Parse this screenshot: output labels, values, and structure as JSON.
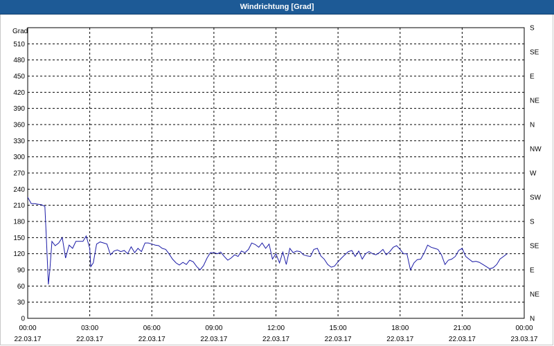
{
  "window": {
    "title": "Windrichtung [Grad]"
  },
  "colors": {
    "titlebar": "#1d5a96",
    "line": "#1a1aa6",
    "grid": "#000000"
  },
  "chart_data": {
    "type": "line",
    "title": "Windrichtung [Grad]",
    "ylabel": "Grad",
    "ylim": [
      0,
      540
    ],
    "yticks": [
      0,
      30,
      60,
      90,
      120,
      150,
      180,
      210,
      240,
      270,
      300,
      330,
      360,
      390,
      420,
      450,
      480,
      510
    ],
    "right_axis_labels": [
      "N",
      "NE",
      "E",
      "SE",
      "S",
      "SW",
      "W",
      "NW",
      "N",
      "NE",
      "E",
      "SE",
      "S"
    ],
    "xlim_hours": [
      0,
      24
    ],
    "xticks": [
      {
        "time": "00:00",
        "date": "22.03.17"
      },
      {
        "time": "03:00",
        "date": "22.03.17"
      },
      {
        "time": "06:00",
        "date": "22.03.17"
      },
      {
        "time": "09:00",
        "date": "22.03.17"
      },
      {
        "time": "12:00",
        "date": "22.03.17"
      },
      {
        "time": "15:00",
        "date": "22.03.17"
      },
      {
        "time": "18:00",
        "date": "22.03.17"
      },
      {
        "time": "21:00",
        "date": "22.03.17"
      },
      {
        "time": "00:00",
        "date": "23.03.17"
      }
    ],
    "grid": true,
    "series": [
      {
        "x_hours": [
          0,
          0.17,
          0.33,
          0.5,
          0.67,
          0.83,
          0.9,
          1.0,
          1.07,
          1.17,
          1.33,
          1.5,
          1.67,
          1.83,
          2.0,
          2.17,
          2.33,
          2.5,
          2.67,
          2.83,
          3.0,
          3.05,
          3.17,
          3.33,
          3.5,
          3.67,
          3.83,
          4.0,
          4.17,
          4.33,
          4.5,
          4.67,
          4.83,
          5.0,
          5.17,
          5.33,
          5.5,
          5.67,
          5.83,
          6.0,
          6.17,
          6.33,
          6.5,
          6.67,
          6.83,
          7.0,
          7.17,
          7.33,
          7.5,
          7.67,
          7.83,
          8.0,
          8.17,
          8.33,
          8.5,
          8.67,
          8.83,
          9.0,
          9.17,
          9.33,
          9.5,
          9.67,
          9.83,
          10.0,
          10.17,
          10.33,
          10.5,
          10.67,
          10.83,
          11.0,
          11.17,
          11.33,
          11.5,
          11.67,
          11.83,
          12.0,
          12.17,
          12.33,
          12.5,
          12.67,
          12.83,
          13.0,
          13.17,
          13.33,
          13.5,
          13.67,
          13.83,
          14.0,
          14.17,
          14.33,
          14.5,
          14.67,
          14.83,
          15.0,
          15.17,
          15.33,
          15.5,
          15.67,
          15.83,
          16.0,
          16.17,
          16.33,
          16.5,
          16.67,
          16.83,
          17.0,
          17.17,
          17.33,
          17.5,
          17.67,
          17.83,
          18.0,
          18.17,
          18.33,
          18.5,
          18.67,
          18.83,
          19.0,
          19.17,
          19.33,
          19.5,
          19.67,
          19.83,
          20.0,
          20.17,
          20.33,
          20.5,
          20.67,
          20.83,
          21.0,
          21.17,
          21.33,
          21.5,
          21.67,
          21.83,
          22.0,
          22.17,
          22.33,
          22.5,
          22.67,
          22.83,
          23.0,
          23.17,
          23.33,
          23.5,
          23.67,
          23.83
        ],
        "values": [
          225,
          213,
          213,
          212,
          211,
          208,
          150,
          63,
          90,
          143,
          135,
          140,
          150,
          112,
          136,
          130,
          143,
          143,
          143,
          153,
          130,
          96,
          103,
          138,
          142,
          140,
          138,
          118,
          125,
          127,
          124,
          126,
          120,
          133,
          122,
          130,
          124,
          140,
          140,
          138,
          136,
          135,
          130,
          128,
          120,
          110,
          103,
          99,
          104,
          100,
          108,
          105,
          96,
          90,
          98,
          112,
          122,
          122,
          120,
          123,
          115,
          108,
          112,
          118,
          115,
          125,
          122,
          128,
          140,
          137,
          132,
          140,
          130,
          138,
          110,
          120,
          103,
          123,
          100,
          130,
          122,
          125,
          124,
          118,
          116,
          115,
          128,
          130,
          116,
          110,
          100,
          95,
          97,
          105,
          112,
          118,
          124,
          126,
          115,
          125,
          110,
          120,
          124,
          120,
          118,
          122,
          128,
          118,
          124,
          132,
          135,
          128,
          120,
          120,
          90,
          103,
          109,
          110,
          122,
          136,
          132,
          130,
          128,
          118,
          100,
          108,
          110,
          115,
          126,
          130,
          115,
          110,
          105,
          106,
          104,
          100,
          96,
          92,
          94,
          100,
          110,
          115,
          120
        ]
      }
    ]
  }
}
